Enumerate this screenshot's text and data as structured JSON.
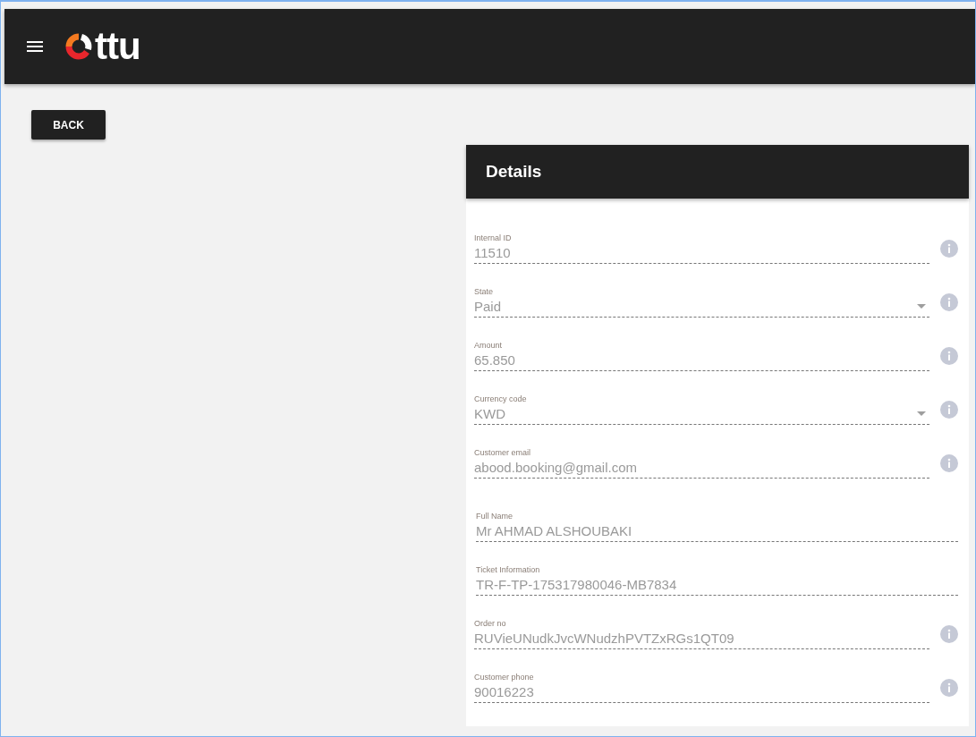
{
  "header": {
    "logo_text": "ttu"
  },
  "back_button": "BACK",
  "details": {
    "title": "Details",
    "fields": [
      {
        "label": "Internal ID",
        "value": "11510",
        "kind": "text",
        "info": true
      },
      {
        "label": "State",
        "value": "Paid",
        "kind": "select",
        "info": true
      },
      {
        "label": "Amount",
        "value": "65.850",
        "kind": "text",
        "info": true
      },
      {
        "label": "Currency code",
        "value": "KWD",
        "kind": "select",
        "info": true
      },
      {
        "label": "Customer email",
        "value": "abood.booking@gmail.com",
        "kind": "text",
        "info": true
      },
      {
        "label": "Full Name",
        "value": "Mr AHMAD ALSHOUBAKI",
        "kind": "text",
        "info": false
      },
      {
        "label": "Ticket Information",
        "value": "TR-F-TP-175317980046-MB7834",
        "kind": "text",
        "info": false
      },
      {
        "label": "Order no",
        "value": "RUVieUNudkJvcWNudzhPVTZxRGs1QT09",
        "kind": "text",
        "info": true
      },
      {
        "label": "Customer phone",
        "value": "90016223",
        "kind": "text",
        "info": true
      }
    ]
  }
}
